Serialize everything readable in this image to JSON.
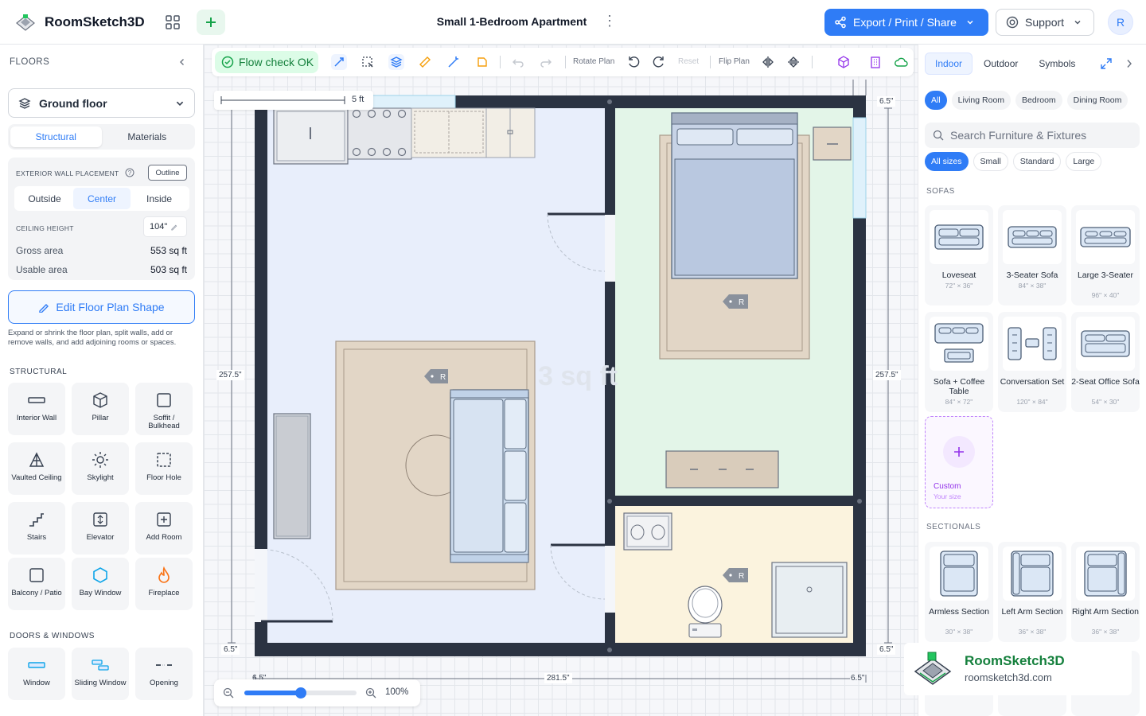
{
  "app": {
    "name": "RoomSketch3D",
    "avatar_initial": "R"
  },
  "header": {
    "doc_title": "Small 1-Bedroom Apartment",
    "export_label": "Export / Print / Share",
    "support_label": "Support"
  },
  "left": {
    "floors_heading": "FLOORS",
    "floor_selected": "Ground floor",
    "tabs": [
      "Structural",
      "Materials"
    ],
    "exterior_wall_label": "EXTERIOR WALL PLACEMENT",
    "outline_label": "Outline",
    "wall_options": [
      "Outside",
      "Center",
      "Inside"
    ],
    "ceiling_label": "CEILING HEIGHT",
    "ceiling_value": "104\"",
    "gross_label": "Gross area",
    "gross_value": "553 sq ft",
    "usable_label": "Usable area",
    "usable_value": "503 sq ft",
    "edit_button": "Edit Floor Plan Shape",
    "help_text": "Expand or shrink the floor plan, split walls, add or remove walls, and add adjoining rooms or spaces.",
    "structural_heading": "STRUCTURAL",
    "structural_items": [
      "Interior Wall",
      "Pillar",
      "Soffit / Bulkhead",
      "Vaulted Ceiling",
      "Skylight",
      "Floor Hole",
      "Stairs",
      "Elevator",
      "Add Room",
      "Balcony / Patio",
      "Bay Window",
      "Fireplace"
    ],
    "doors_heading": "DOORS & WINDOWS",
    "door_items": [
      "Window",
      "Sliding Window",
      "Opening"
    ]
  },
  "toolbar": {
    "flow_check": "Flow check OK",
    "rotate_label": "Rotate Plan",
    "reset_label": "Reset",
    "flip_label": "Flip Plan"
  },
  "plan": {
    "scale_label": "5 ft",
    "dim_top_right": "6.5\"",
    "dim_left": "257.5\"",
    "dim_right": "257.5\"",
    "dim_bottom_left": "6.5\"",
    "dim_bottom_right": "6.5\"",
    "dim_bottom_total": "281.5\"",
    "dim_bottom_left2": "6.5\"",
    "dim_bottom_right2": "6.5\"",
    "watermark_area": "3 sq ft",
    "tag_r": "R",
    "zoom_value": "100%",
    "zoom_fraction": 0.5
  },
  "right": {
    "tabs": [
      "Indoor",
      "Outdoor",
      "Symbols"
    ],
    "room_chips": [
      "All",
      "Living Room",
      "Bedroom",
      "Dining Room"
    ],
    "search_placeholder": "Search Furniture & Fixtures",
    "size_chips": [
      "All sizes",
      "Small",
      "Standard",
      "Large"
    ],
    "sofas_heading": "SOFAS",
    "sofas": [
      {
        "name": "Loveseat",
        "size": "72\" × 36\""
      },
      {
        "name": "3-Seater Sofa",
        "size": "84\" × 38\""
      },
      {
        "name": "Large 3-Seater",
        "size": "96\" × 40\""
      },
      {
        "name": "Sofa + Coffee Table",
        "size": "84\" × 72\""
      },
      {
        "name": "Conversation Set",
        "size": "120\" × 84\""
      },
      {
        "name": "2-Seat Office Sofa",
        "size": "54\" × 30\""
      }
    ],
    "custom_label": "Custom",
    "custom_sub": "Your size",
    "sectionals_heading": "SECTIONALS",
    "sectionals": [
      {
        "name": "Armless Section",
        "size": "30\" × 38\""
      },
      {
        "name": "Left Arm Section",
        "size": "36\" × 38\""
      },
      {
        "name": "Right Arm Section",
        "size": "36\" × 38\""
      }
    ]
  },
  "watermark": {
    "brand": "RoomSketch3D",
    "url": "roomsketch3d.com"
  },
  "colors": {
    "accent": "#2f7cf6",
    "wall": "#2b3342",
    "living": "#e8eefb",
    "bedroom": "#e3f5e8",
    "bath": "#fbf3de",
    "rug": "#e2d6c6"
  }
}
